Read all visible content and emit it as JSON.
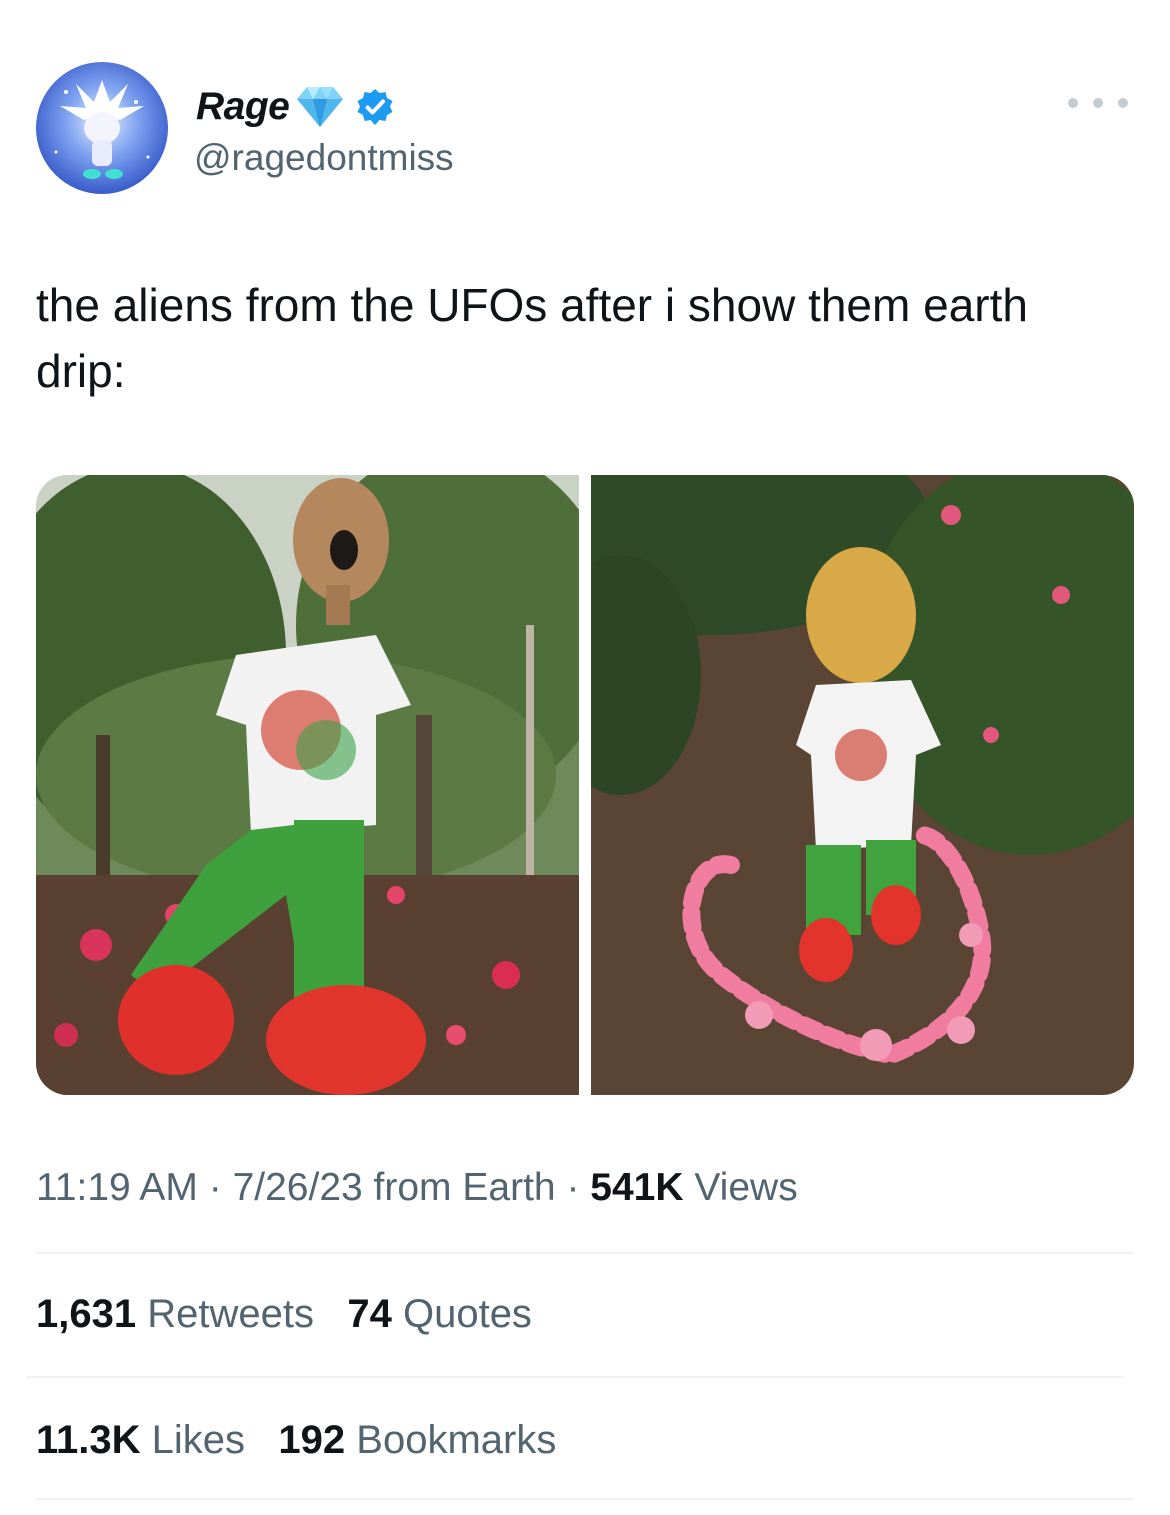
{
  "author": {
    "display_name": "Rage",
    "handle": "@ragedontmiss",
    "badges": [
      "gem-icon",
      "verified-icon"
    ],
    "verified_color": "#1d9bf0"
  },
  "tweet": {
    "text": "the aliens from the UFOs after i show them earth drip:",
    "media_count": 2
  },
  "meta": {
    "time": "11:19 AM",
    "date": "7/26/23",
    "source": "from Earth",
    "separator": "·",
    "views_count": "541K",
    "views_label": "Views"
  },
  "stats": {
    "retweets_count": "1,631",
    "retweets_label": "Retweets",
    "quotes_count": "74",
    "quotes_label": "Quotes",
    "likes_count": "11.3K",
    "likes_label": "Likes",
    "bookmarks_count": "192",
    "bookmarks_label": "Bookmarks"
  },
  "colors": {
    "text_primary": "#0f1419",
    "text_secondary": "#536471",
    "divider": "#eff3f4"
  }
}
